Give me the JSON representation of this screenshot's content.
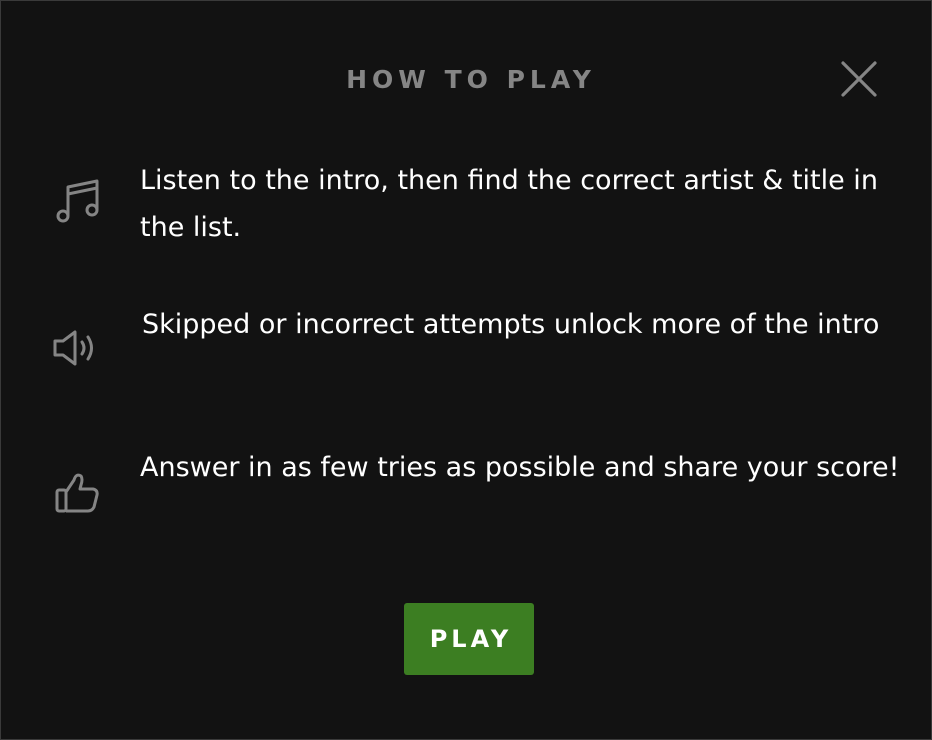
{
  "modal": {
    "title": "HOW TO PLAY",
    "close_icon": "close-icon",
    "steps": [
      {
        "icon": "music-note-icon",
        "text": "Listen to the intro, then find the correct artist & title in the list."
      },
      {
        "icon": "speaker-volume-icon",
        "text": "Skipped or incorrect attempts unlock more of the intro"
      },
      {
        "icon": "thumbs-up-icon",
        "text": "Answer in as few tries as possible and share your score!"
      }
    ],
    "play_label": "PLAY"
  },
  "colors": {
    "background": "#121212",
    "title": "#858585",
    "icon": "#858585",
    "text": "#ffffff",
    "play_button": "#3c7e22",
    "border": "#3a3a3a"
  }
}
